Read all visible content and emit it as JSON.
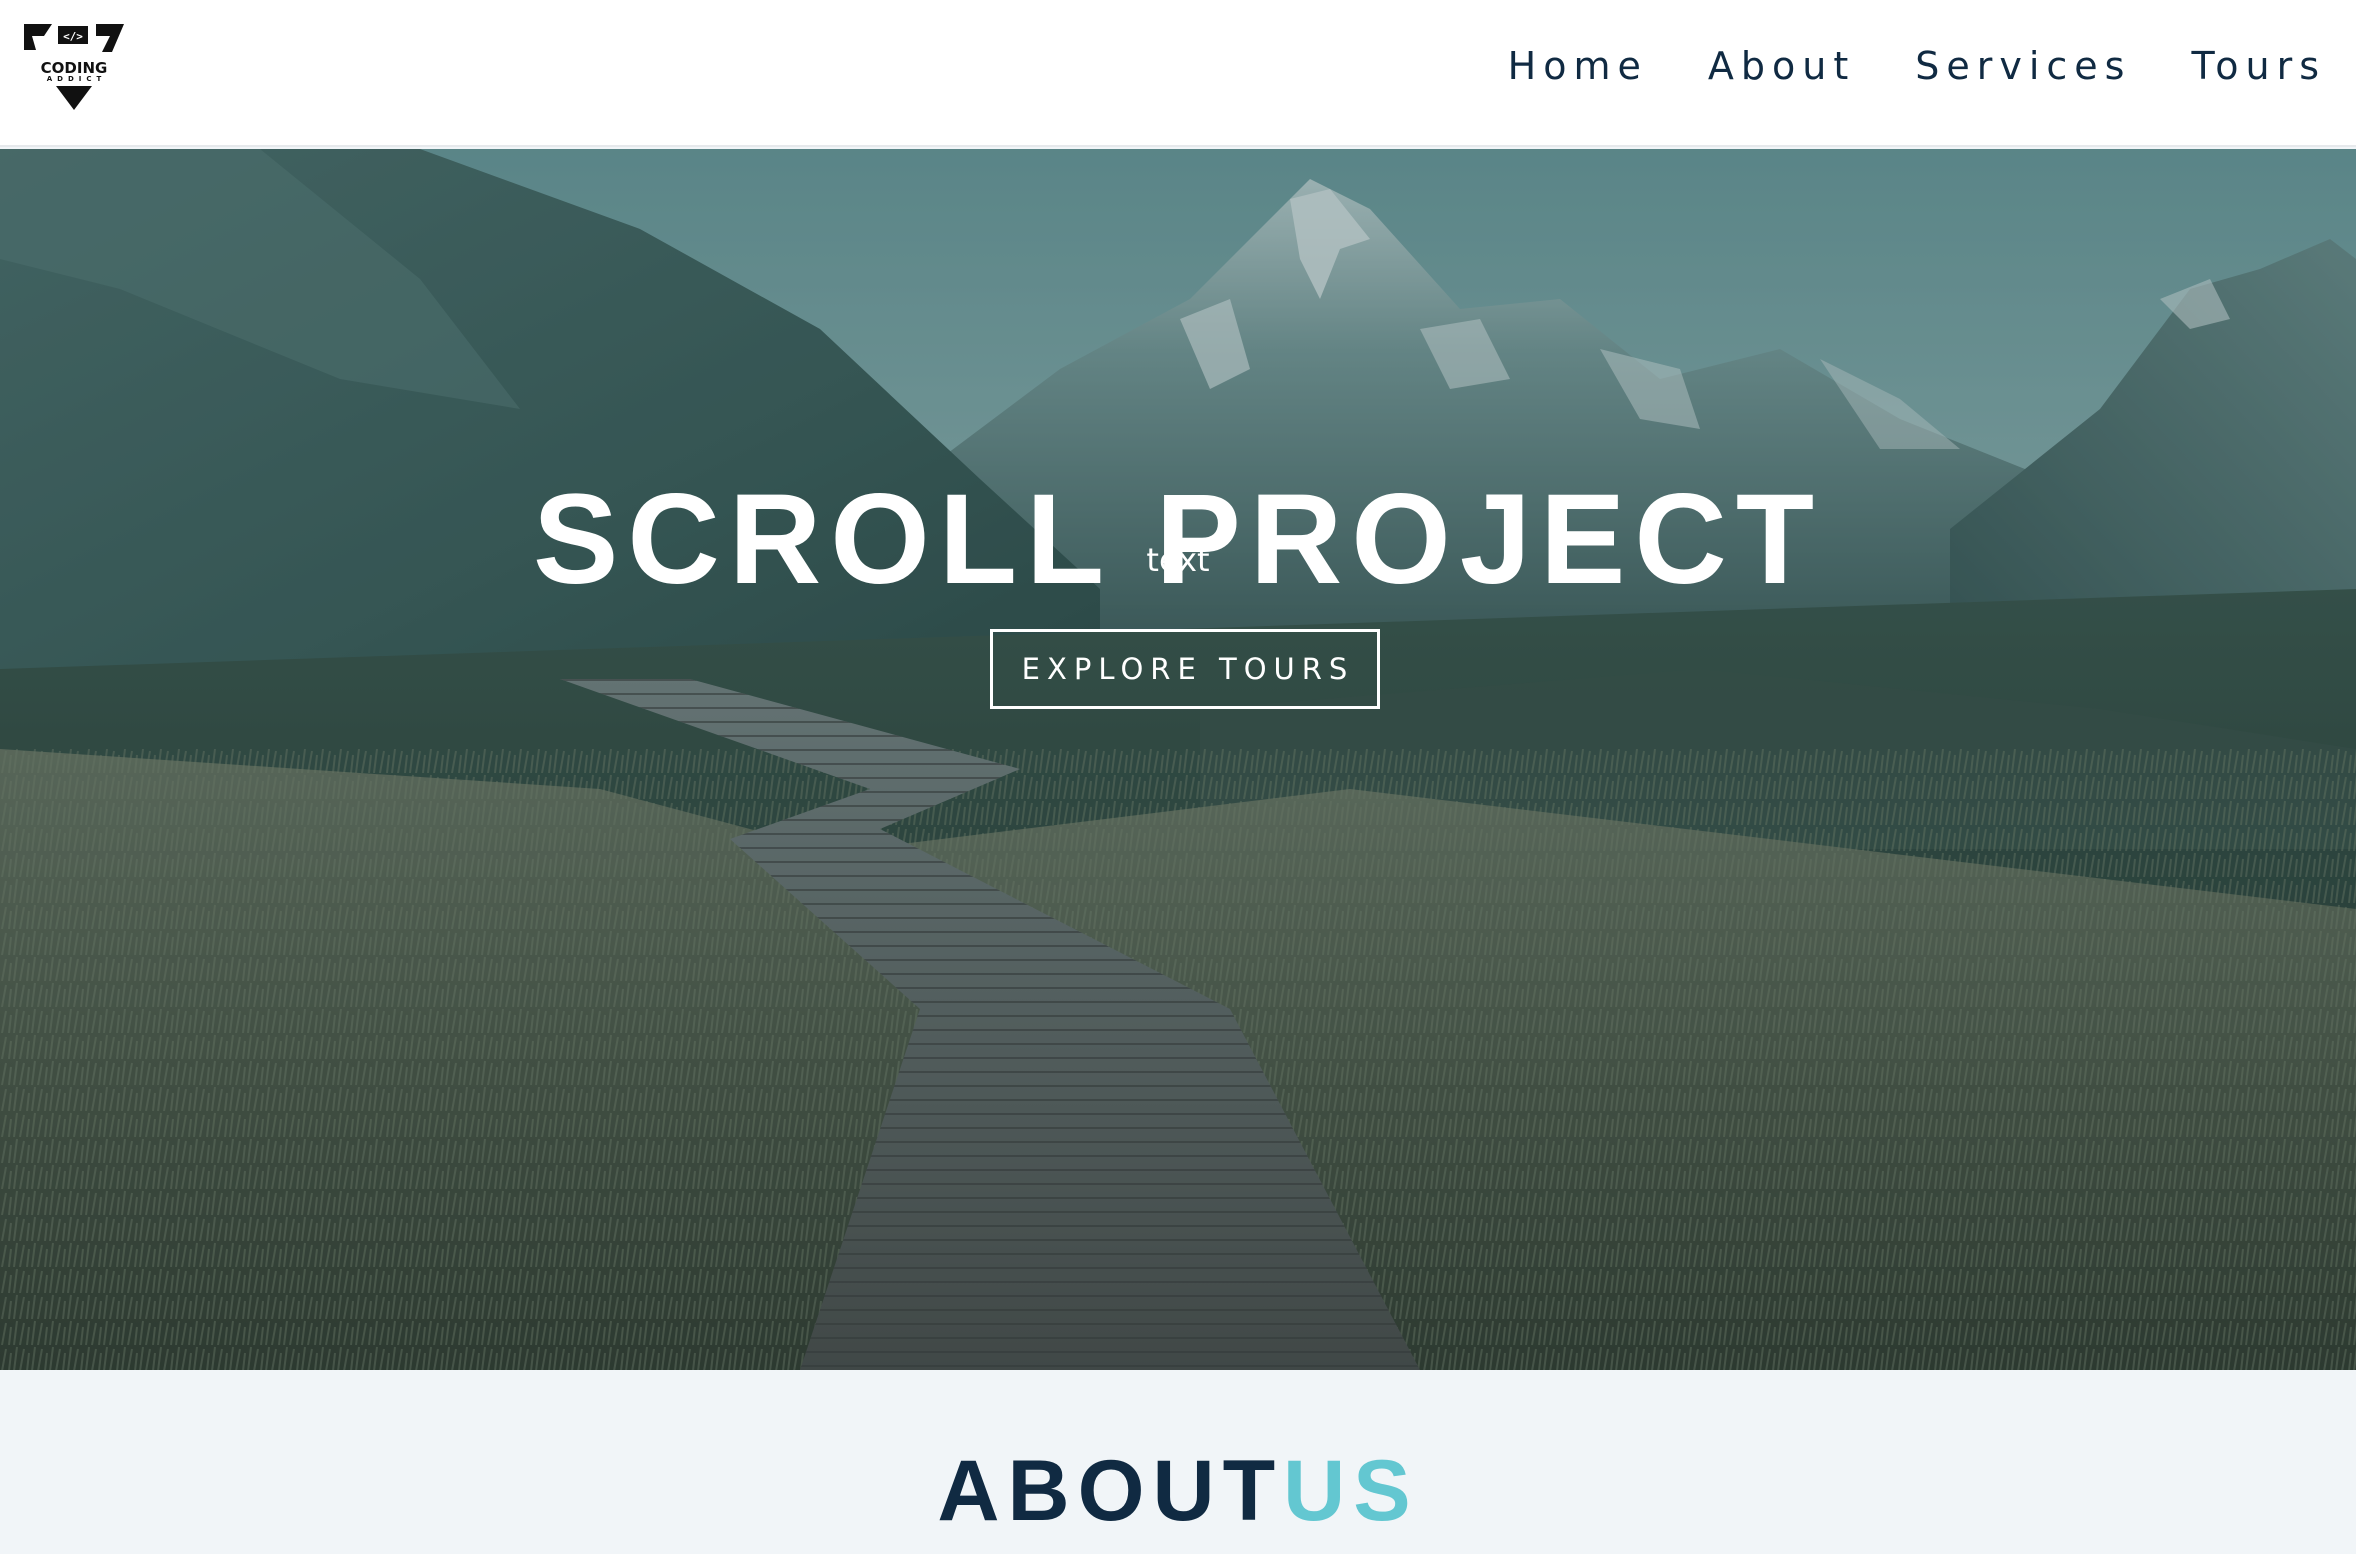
{
  "navbar": {
    "logo": {
      "line1": "CODING",
      "line2": "ADDICT",
      "icon": "code-brackets-icon"
    },
    "links": [
      "Home",
      "About",
      "Services",
      "Tours"
    ]
  },
  "hero": {
    "title": "SCROLL PROJECT",
    "subtitle": "text",
    "button_label": "EXPLORE TOURS",
    "background": "mountain-boardwalk-photo"
  },
  "about": {
    "title_part1": "ABOUT",
    "title_part2": "US"
  },
  "colors": {
    "primary_dark": "#102a42",
    "accent": "#63c7d1",
    "background": "#f1f5f8"
  }
}
